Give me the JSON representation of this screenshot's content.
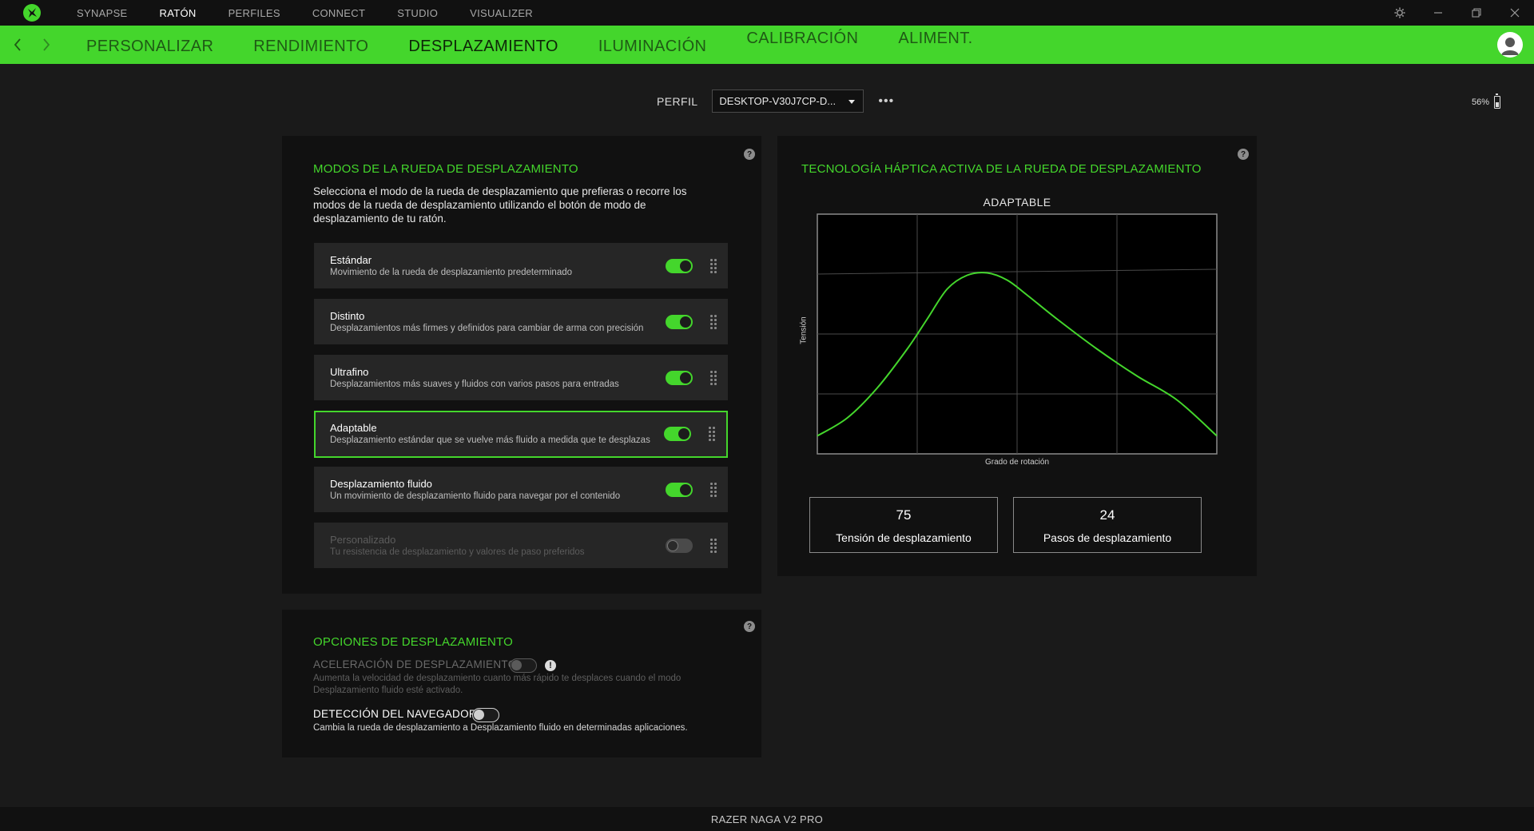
{
  "titlebar": {
    "nav": [
      "SYNAPSE",
      "RATÓN",
      "PERFILES",
      "CONNECT",
      "STUDIO",
      "VISUALIZER"
    ],
    "active": "RATÓN"
  },
  "subnav": {
    "tabs": [
      "PERSONALIZAR",
      "RENDIMIENTO",
      "DESPLAZAMIENTO",
      "ILUMINACIÓN",
      "CALIBRACIÓN",
      "ALIMENT."
    ],
    "active": "DESPLAZAMIENTO"
  },
  "profile": {
    "label": "PERFIL",
    "value": "DESKTOP-V30J7CP-D..."
  },
  "battery": {
    "percent_label": "56%",
    "level": 0.56
  },
  "modes_panel": {
    "title": "MODOS DE LA RUEDA DE DESPLAZAMIENTO",
    "description": "Selecciona el modo de la rueda de desplazamiento que prefieras o recorre los modos de la rueda de desplazamiento utilizando el botón de modo de desplazamiento de tu ratón.",
    "modes": [
      {
        "name": "Estándar",
        "desc": "Movimiento de la rueda de desplazamiento predeterminado",
        "enabled": true,
        "selected": false
      },
      {
        "name": "Distinto",
        "desc": "Desplazamientos más firmes y definidos para cambiar de arma con precisión",
        "enabled": true,
        "selected": false
      },
      {
        "name": "Ultrafino",
        "desc": "Desplazamientos más suaves y fluidos con varios pasos para entradas",
        "enabled": true,
        "selected": false
      },
      {
        "name": "Adaptable",
        "desc": "Desplazamiento estándar que se vuelve más fluido a medida que te desplazas",
        "enabled": true,
        "selected": true
      },
      {
        "name": "Desplazamiento fluido",
        "desc": "Un movimiento de desplazamiento fluido para navegar por el contenido",
        "enabled": true,
        "selected": false
      },
      {
        "name": "Personalizado",
        "desc": "Tu resistencia de desplazamiento y valores de paso preferidos",
        "enabled": false,
        "selected": false
      }
    ]
  },
  "options_panel": {
    "title": "OPCIONES DE DESPLAZAMIENTO",
    "acceleration": {
      "label": "ACELERACIÓN DE DESPLAZAMIENTO",
      "desc_line1": "Aumenta la velocidad de desplazamiento cuanto más rápido te desplaces cuando el modo",
      "desc_line2": "Desplazamiento fluido esté activado.",
      "enabled": false,
      "disabled": true
    },
    "browser_detection": {
      "label": "DETECCIÓN DEL NAVEGADOR",
      "desc": "Cambia la rueda de desplazamiento a Desplazamiento fluido en determinadas aplicaciones.",
      "enabled": false
    }
  },
  "haptic_panel": {
    "title": "TECNOLOGÍA HÁPTICA ACTIVA DE LA RUEDA DE DESPLAZAMIENTO",
    "tension": {
      "value": "75",
      "label": "Tensión de desplazamiento"
    },
    "steps": {
      "value": "24",
      "label": "Pasos de desplazamiento"
    }
  },
  "chart_data": {
    "type": "line",
    "title": "ADAPTABLE",
    "xlabel": "Grado de rotación",
    "ylabel": "Tensión",
    "xlim": [
      0,
      4
    ],
    "ylim": [
      0,
      4
    ],
    "grid": true,
    "line_color": "#44d62c",
    "series": [
      {
        "x": [
          0,
          0.3,
          0.6,
          0.9,
          1.1,
          1.3,
          1.5,
          1.7,
          1.9,
          2.1,
          2.4,
          2.8,
          3.2,
          3.6,
          4.0
        ],
        "y": [
          0.3,
          0.6,
          1.1,
          1.75,
          2.25,
          2.75,
          2.98,
          3.02,
          2.9,
          2.65,
          2.25,
          1.75,
          1.3,
          0.9,
          0.3
        ]
      },
      {
        "x": [
          0,
          4
        ],
        "y": [
          3.0,
          3.08
        ]
      }
    ]
  },
  "footer": {
    "device": "RAZER NAGA V2 PRO"
  },
  "colors": {
    "accent": "#44d62c",
    "panel": "#111111",
    "background": "#1a1a1a",
    "row": "#262626"
  }
}
